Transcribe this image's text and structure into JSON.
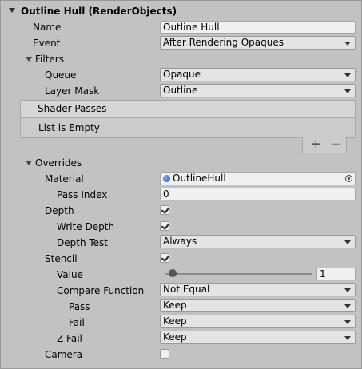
{
  "header": {
    "title": "Outline Hull (RenderObjects)"
  },
  "name": {
    "label": "Name",
    "value": "Outline Hull"
  },
  "event": {
    "label": "Event",
    "value": "After Rendering Opaques"
  },
  "filters": {
    "label": "Filters",
    "queue": {
      "label": "Queue",
      "value": "Opaque"
    },
    "layer_mask": {
      "label": "Layer Mask",
      "value": "Outline"
    }
  },
  "shader_passes": {
    "header": "Shader Passes",
    "empty_text": "List is Empty",
    "add_label": "+",
    "remove_label": "−"
  },
  "overrides": {
    "label": "Overrides",
    "material": {
      "label": "Material",
      "value": "OutlineHull"
    },
    "pass_index": {
      "label": "Pass Index",
      "value": "0"
    },
    "depth": {
      "label": "Depth",
      "checked": true
    },
    "write_depth": {
      "label": "Write Depth",
      "checked": true
    },
    "depth_test": {
      "label": "Depth Test",
      "value": "Always"
    },
    "stencil": {
      "label": "Stencil",
      "checked": true
    },
    "value": {
      "label": "Value",
      "value": "1",
      "slider_fraction": 0.05
    },
    "compare_function": {
      "label": "Compare Function",
      "value": "Not Equal"
    },
    "pass": {
      "label": "Pass",
      "value": "Keep"
    },
    "fail": {
      "label": "Fail",
      "value": "Keep"
    },
    "z_fail": {
      "label": "Z Fail",
      "value": "Keep"
    },
    "camera": {
      "label": "Camera",
      "checked": false
    }
  }
}
